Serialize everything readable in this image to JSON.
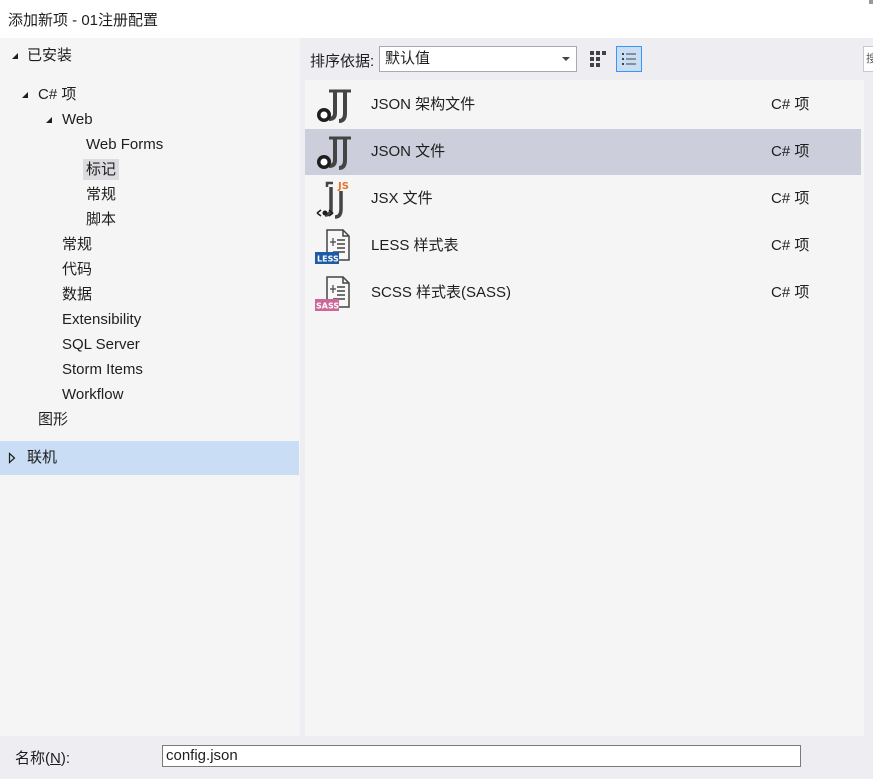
{
  "window": {
    "title": "添加新项 - 01注册配置"
  },
  "tree": {
    "installed": "已安装",
    "csharp": "C# 项",
    "web": "Web",
    "web_forms": "Web Forms",
    "markup": "标记",
    "general_web": "常规",
    "script": "脚本",
    "general": "常规",
    "code": "代码",
    "data": "数据",
    "extensibility": "Extensibility",
    "sql_server": "SQL Server",
    "storm_items": "Storm Items",
    "workflow": "Workflow",
    "graphics": "图形",
    "online": "联机"
  },
  "toolbar": {
    "sort_label": "排序依据:",
    "sort_value": "默认值",
    "search_stub": "搜"
  },
  "items": [
    {
      "name": "JSON 架构文件",
      "type": "C# 项",
      "icon": "json-schema-icon"
    },
    {
      "name": "JSON 文件",
      "type": "C# 项",
      "icon": "json-file-icon"
    },
    {
      "name": "JSX 文件",
      "type": "C# 项",
      "icon": "jsx-file-icon",
      "badge": "JS"
    },
    {
      "name": "LESS 样式表",
      "type": "C# 项",
      "icon": "less-file-icon",
      "badge": "LESS"
    },
    {
      "name": "SCSS 样式表(SASS)",
      "type": "C# 项",
      "icon": "scss-file-icon",
      "badge": "SASS"
    }
  ],
  "bottom": {
    "name_label_pre": "名称(",
    "name_label_key": "N",
    "name_label_post": "):",
    "name_value": "config.json"
  },
  "colors": {
    "selected_row": "#cccedb",
    "online_row": "#c9ddf4",
    "less_badge": "#1f5aa6",
    "sass_badge": "#cd6799",
    "js_badge": "#e8712b"
  }
}
